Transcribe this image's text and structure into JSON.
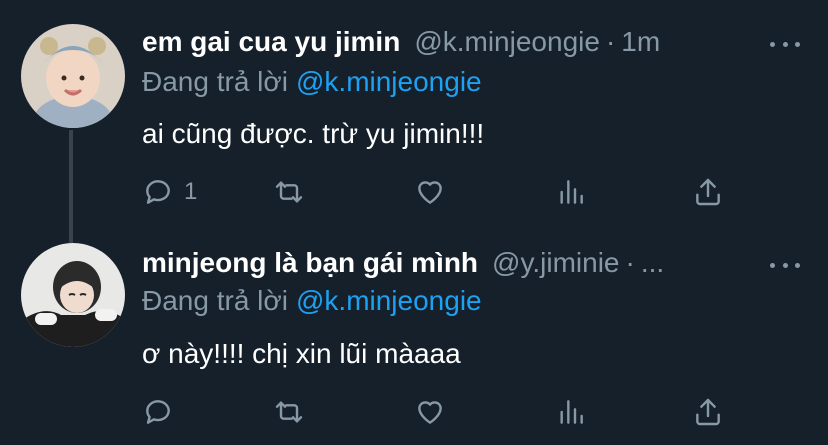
{
  "tweets": [
    {
      "display_name": "em gai cua yu jimin",
      "handle": "@k.minjeongie",
      "separator": "·",
      "time": "1m",
      "reply_prefix": "Đang trả lời",
      "reply_mention": "@k.minjeongie",
      "text": "ai cũng được. trừ yu jimin!!!",
      "reply_count": "1"
    },
    {
      "display_name": "minjeong là bạn gái mình",
      "handle": "@y.jiminie",
      "separator": "·",
      "time": "...",
      "reply_prefix": "Đang trả lời",
      "reply_mention": "@k.minjeongie",
      "text": "ơ này!!!! chị xin lũi màaaa",
      "reply_count": ""
    }
  ],
  "colors": {
    "background": "#15202b",
    "text_primary": "#ffffff",
    "text_secondary": "#8899a6",
    "accent": "#1da1f2",
    "thread_line": "#38444d"
  },
  "icons": [
    "reply-icon",
    "retweet-icon",
    "like-icon",
    "stats-icon",
    "share-icon",
    "more-icon"
  ]
}
